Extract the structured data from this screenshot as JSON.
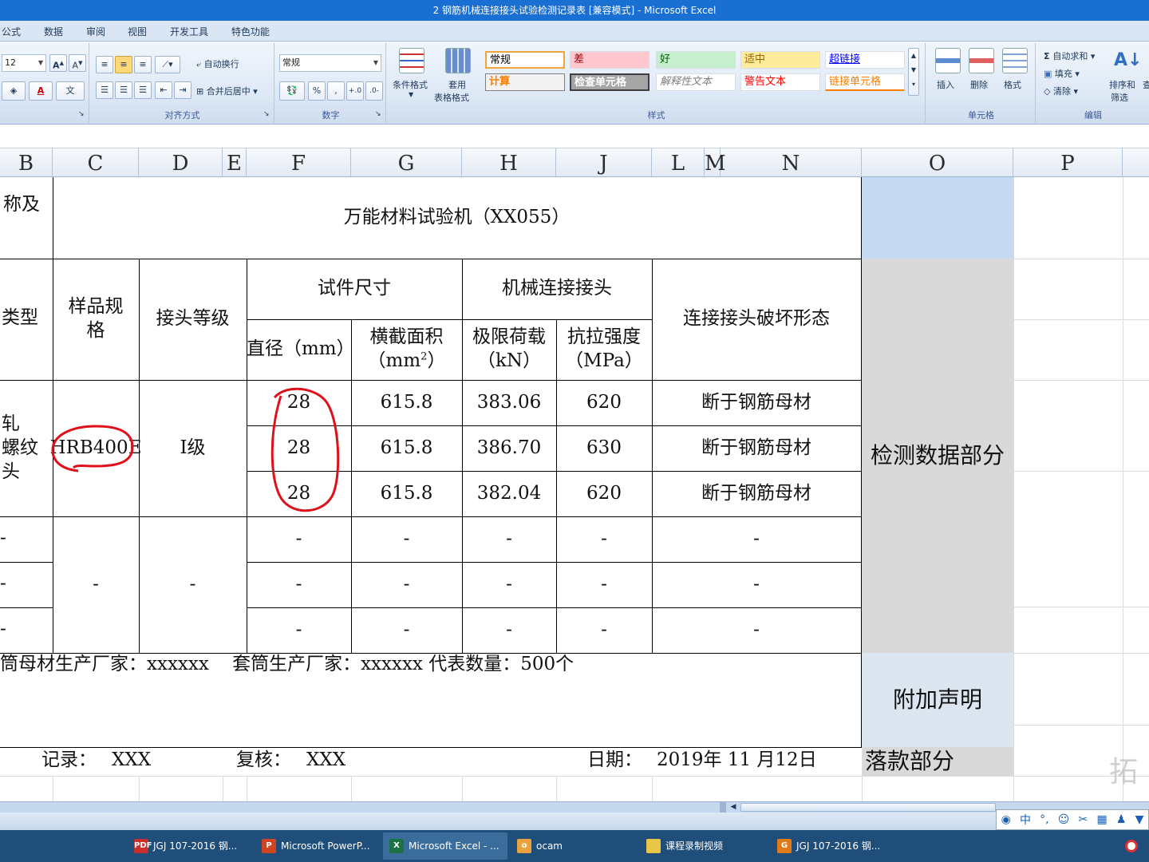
{
  "window": {
    "title": "2  钢筋机械连接接头试验检测记录表  [兼容模式] - Microsoft Excel"
  },
  "ribbon": {
    "tabs": [
      "公式",
      "数据",
      "审阅",
      "视图",
      "开发工具",
      "特色功能"
    ],
    "font": {
      "size": "12"
    },
    "alignment": {
      "wrap": "自动换行",
      "merge": "合并后居中",
      "title": "对齐方式"
    },
    "number": {
      "format": "常规",
      "percent": "%",
      "comma": ",",
      "title": "数字"
    },
    "styles": {
      "conditional": "条件格式",
      "table_format_1": "套用",
      "table_format_2": "表格格式",
      "cells": [
        {
          "label": "常规",
          "bg": "#ffffff",
          "fg": "#000000"
        },
        {
          "label": "差",
          "bg": "#ffc7ce",
          "fg": "#9c0006"
        },
        {
          "label": "好",
          "bg": "#c6efce",
          "fg": "#006100"
        },
        {
          "label": "适中",
          "bg": "#ffeb9c",
          "fg": "#9c6500"
        },
        {
          "label": "超链接",
          "bg": "#ffffff",
          "fg": "#0000ff"
        },
        {
          "label": "计算",
          "bg": "#f2f2f2",
          "fg": "#fa7d00"
        },
        {
          "label": "检查单元格",
          "bg": "#a5a5a5",
          "fg": "#ffffff"
        },
        {
          "label": "解释性文本",
          "bg": "#ffffff",
          "fg": "#7f7f7f"
        },
        {
          "label": "警告文本",
          "bg": "#ffffff",
          "fg": "#ff0000"
        },
        {
          "label": "链接单元格",
          "bg": "#ffffff",
          "fg": "#fa7d00"
        }
      ],
      "title": "样式"
    },
    "cells_group": {
      "insert": "插入",
      "delete": "删除",
      "format": "格式",
      "title": "单元格"
    },
    "editing": {
      "autosum": "自动求和",
      "fill": "填充",
      "clear": "清除",
      "sort_1": "排序和",
      "sort_2": "筛选",
      "find": "查",
      "title": "编辑"
    }
  },
  "columns": [
    "B",
    "C",
    "D",
    "E",
    "F",
    "G",
    "H",
    "J",
    "L",
    "M",
    "N",
    "O",
    "P"
  ],
  "table": {
    "left_cut": {
      "r1": "称及",
      "r2": "类型",
      "r3a": "轧",
      "r3b": "螺纹",
      "r3c": "头",
      "dash": "-"
    },
    "equipment": "万能材料试验机（XX055）",
    "headers": {
      "spec": "样品规格",
      "grade": "接头等级",
      "size": "试件尺寸",
      "mech": "机械连接接头",
      "failure": "连接接头破坏形态",
      "diameter": "直径（mm）",
      "area_1": "横截面积",
      "area_2": "（mm",
      "area_sup": "2",
      "area_3": "）",
      "load_1": "极限荷载",
      "load_2": "（kN）",
      "strength_1": "抗拉强度",
      "strength_2": "（MPa）"
    },
    "spec_value": "HRB400E",
    "grade_value": "Ⅰ级",
    "rows": [
      {
        "diameter": "28",
        "area": "615.8",
        "load": "383.06",
        "strength": "620",
        "failure": "断于钢筋母材"
      },
      {
        "diameter": "28",
        "area": "615.8",
        "load": "386.70",
        "strength": "630",
        "failure": "断于钢筋母材"
      },
      {
        "diameter": "28",
        "area": "615.8",
        "load": "382.04",
        "strength": "620",
        "failure": "断于钢筋母材"
      }
    ],
    "empty_rows": [
      {
        "diameter": "-",
        "area": "-",
        "load": "-",
        "strength": "-",
        "failure": "-"
      },
      {
        "diameter": "-",
        "area": "-",
        "load": "-",
        "strength": "-",
        "failure": "-"
      },
      {
        "diameter": "-",
        "area": "-",
        "load": "-",
        "strength": "-",
        "failure": "-"
      }
    ],
    "empty_merged": {
      "spec": "-",
      "grade": "-"
    },
    "footer": "筒母材生产厂家：xxxxxx    套筒生产厂家：xxxxxx 代表数量：500个",
    "sign": {
      "record_label": "记录：",
      "record_value": "XXX",
      "review_label": "复核：",
      "review_value": "XXX",
      "date_label": "日期：",
      "date_value": "2019年 11 月12日"
    }
  },
  "side_labels": {
    "data": "检测数据部分",
    "note": "附加声明",
    "sign": "落款部分"
  },
  "ime": {
    "mode": "中"
  },
  "taskbar": [
    {
      "label": "JGJ 107-2016 钢...",
      "color": "#c9302c",
      "icon": "PDF"
    },
    {
      "label": "Microsoft PowerP...",
      "color": "#d04423",
      "icon": "P"
    },
    {
      "label": "Microsoft Excel - ...",
      "color": "#1e7145",
      "icon": "X"
    },
    {
      "label": "ocam",
      "color": "#e8a33d",
      "icon": "o"
    },
    {
      "label": "课程录制视频",
      "color": "#e8c547",
      "icon": ""
    },
    {
      "label": "JGJ 107-2016 钢...",
      "color": "#e07b1a",
      "icon": "G"
    }
  ],
  "colors": {
    "side_blue": "#c5d9f1",
    "side_gray": "#d9d9d9",
    "side_light": "#dce6f1",
    "annotation": "#e0101a"
  }
}
